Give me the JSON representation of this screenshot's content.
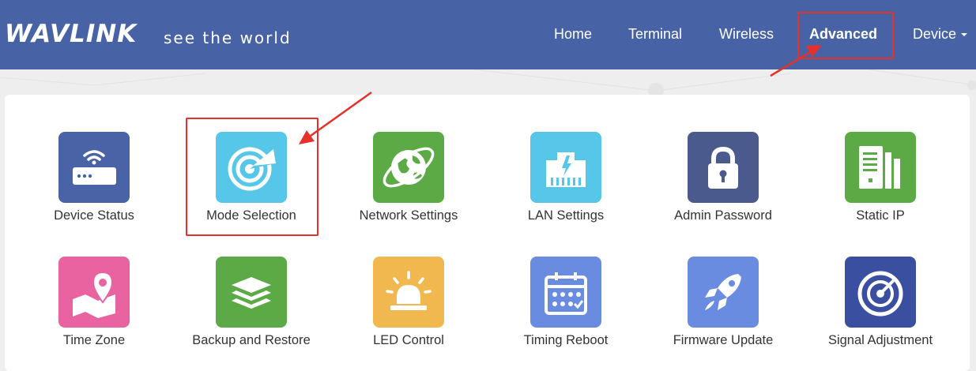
{
  "brand": {
    "logo": "WAVLINK",
    "tagline": "see the world"
  },
  "nav": {
    "items": [
      "Home",
      "Terminal",
      "Wireless",
      "Advanced",
      "Device"
    ],
    "active": "Advanced"
  },
  "tiles": [
    {
      "label": "Device Status",
      "icon": "router-wifi-icon",
      "color": "#4a62a6"
    },
    {
      "label": "Mode Selection",
      "icon": "radar-icon",
      "color": "#56c7e8"
    },
    {
      "label": "Network Settings",
      "icon": "globe-orbit-icon",
      "color": "#5caa45"
    },
    {
      "label": "LAN Settings",
      "icon": "ethernet-port-icon",
      "color": "#56c7e8"
    },
    {
      "label": "Admin Password",
      "icon": "padlock-icon",
      "color": "#4a5a8c"
    },
    {
      "label": "Static IP",
      "icon": "server-bars-icon",
      "color": "#5caa45"
    },
    {
      "label": "Time Zone",
      "icon": "map-pin-icon",
      "color": "#e863a0"
    },
    {
      "label": "Backup and Restore",
      "icon": "layers-icon",
      "color": "#5caa45"
    },
    {
      "label": "LED Control",
      "icon": "led-siren-icon",
      "color": "#f2b850"
    },
    {
      "label": "Timing Reboot",
      "icon": "calendar-icon",
      "color": "#6a8ce0"
    },
    {
      "label": "Firmware Update",
      "icon": "rocket-icon",
      "color": "#6a8ce0"
    },
    {
      "label": "Signal Adjustment",
      "icon": "signal-dial-icon",
      "color": "#3b4fa0"
    }
  ],
  "annotation_color": "#e8302a"
}
